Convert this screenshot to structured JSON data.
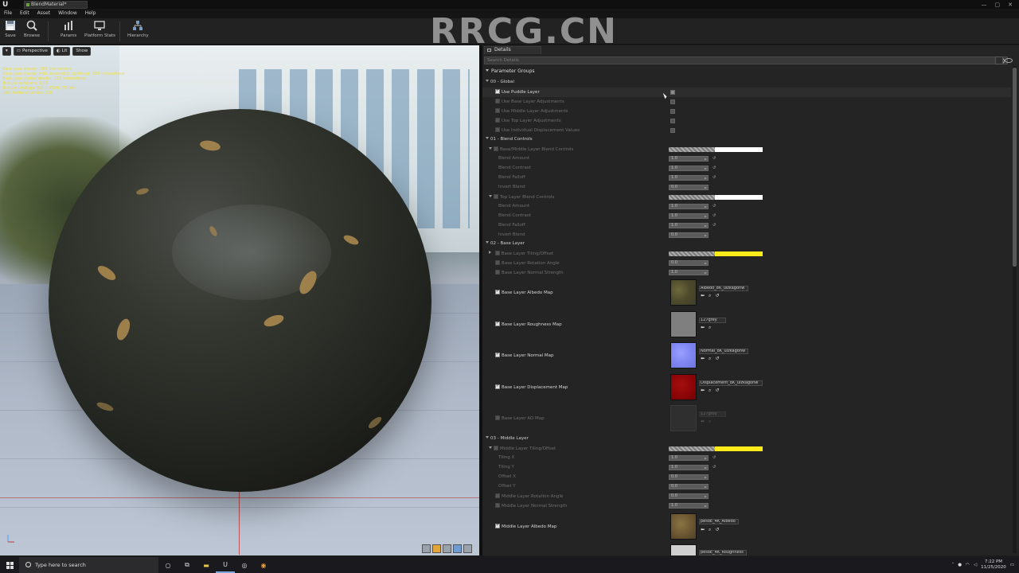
{
  "title_tab": "BlendMaterial*",
  "menu": [
    "File",
    "Edit",
    "Asset",
    "Window",
    "Help"
  ],
  "toolbar": {
    "save": "Save",
    "browse": "Browse",
    "params": "Params",
    "platform_stats": "Platform Stats",
    "hierarchy": "Hierarchy"
  },
  "viewport": {
    "perspective": "Perspective",
    "lit": "Lit",
    "show": "Show",
    "stats": [
      "Base pass shader: 288 instructions",
      "Base pass shader with Volumetric Lightmap: 288 instructions",
      "Base pass vertex shader: 132 instructions",
      "Texture samplers: 4/16",
      "Texture Lookups (Est.): VS(0), PS(14)",
      "User textures added: 5/8"
    ]
  },
  "details": {
    "tab": "Details",
    "search_placeholder": "Search Details",
    "parameter_groups": "Parameter Groups",
    "groups": {
      "g00": "00 - Global",
      "g01": "01 - Blend Controls",
      "g02": "02 - Base Layer",
      "g03": "03 - Middle Layer"
    },
    "global": {
      "use_puddle": "Use Puddle Layer",
      "use_base_adj": "Use Base Layer Adjustments",
      "use_middle_adj": "Use Middle Layer Adjustments",
      "use_top_adj": "Use Top Layer Adjustments",
      "use_indiv_disp": "Use Individual Displacement Values"
    },
    "blend": {
      "base_middle": "Base/Middle Layer Blend Controls",
      "top": "Top Layer Blend Controls",
      "blend_amount": "Blend Amount",
      "blend_contrast": "Blend Contrast",
      "blend_falloff": "Blend Falloff",
      "invert_blend": "Invert Blend",
      "v_amount": "1.0",
      "v_contrast": "1.0",
      "v_falloff": "1.0",
      "v_invert": "0.0",
      "t_amount": "1.0",
      "t_contrast": "1.0",
      "t_falloff": "1.0",
      "t_invert": "0.0"
    },
    "base": {
      "tiling_offset": "Base Layer Tiling/Offset",
      "rotation_angle": "Base Layer Rotation Angle",
      "normal_strength": "Base Layer Normal Strength",
      "v_rotation": "0.0",
      "v_normal": "1.0",
      "albedo_map": "Base Layer Albedo Map",
      "roughness_map": "Base Layer Roughness Map",
      "normal_map": "Base Layer Normal Map",
      "displacement_map": "Base Layer Displacement Map",
      "ao_map": "Base Layer AO Map",
      "albedo_tex": "Albedo_8K_ulzkagohw",
      "roughness_tex": "127grey",
      "normal_tex": "Normal_8K_ulzkagohw",
      "displacement_tex": "Displacement_8K_ulzkagohw",
      "ao_tex": "127grey"
    },
    "middle": {
      "tiling_offset": "Middle Layer Tiling/Offset",
      "tiling_x": "Tiling X",
      "tiling_y": "Tiling Y",
      "offset_x": "Offset X",
      "offset_y": "Offset Y",
      "rotation_angle": "Middle Layer Rotation Angle",
      "normal_strength": "Middle Layer Normal Strength",
      "albedo_map": "Middle Layer Albedo Map",
      "v_tx": "1.0",
      "v_ty": "1.0",
      "v_ox": "0.0",
      "v_oy": "0.0",
      "v_rot": "0.0",
      "v_norm": "1.0",
      "albedo_tex": "pesoE_4K_Albedo",
      "roughness_tex": "pesoE_4K_Roughness"
    }
  },
  "taskbar": {
    "search": "Type here to search",
    "time": "7:22 PM",
    "date": "11/25/2020"
  },
  "watermark": "RRCG.CN",
  "colors": {
    "white_swatch": "#ffffff",
    "yellow_swatch": "#ffeb1a",
    "accent": "#7aa7d8"
  }
}
